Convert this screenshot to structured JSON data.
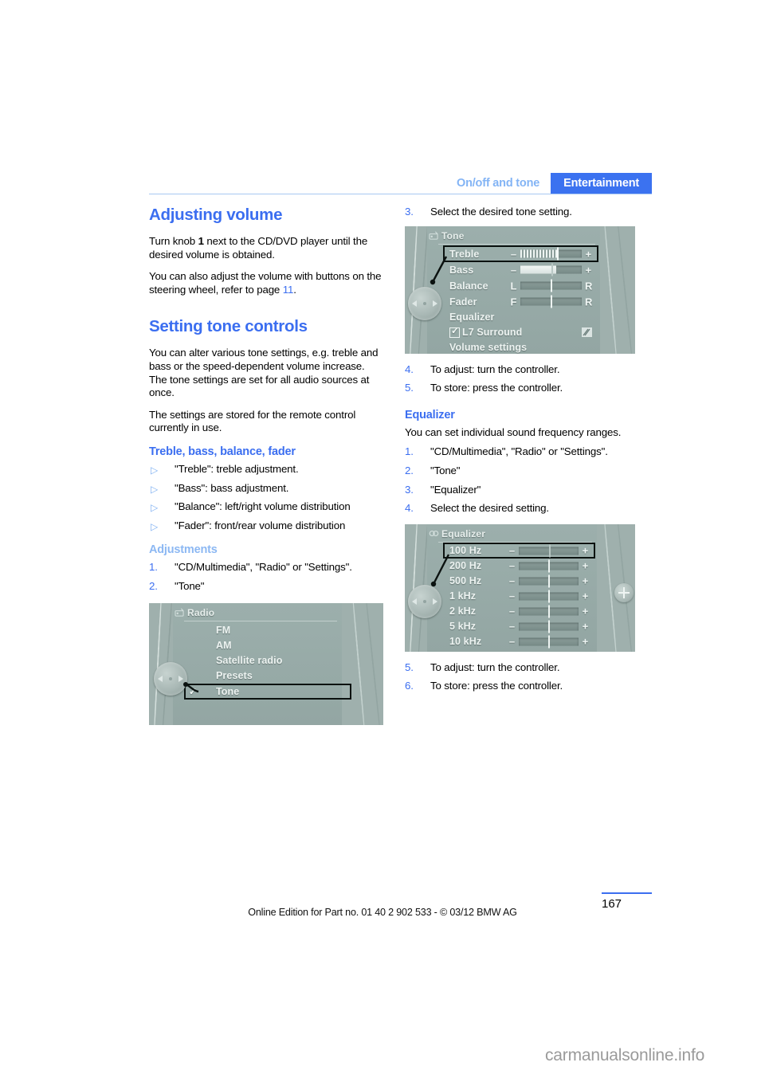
{
  "header": {
    "secondary_tab": "On/off and tone",
    "primary_tab": "Entertainment"
  },
  "colors": {
    "accent_blue": "#3b6ef0",
    "light_blue": "#8cb8f3",
    "tab_blue": "#3b72f0",
    "screen_gray": "#9fb0ad"
  },
  "left_column": {
    "heading_volume": "Adjusting volume",
    "para_volume_1_pre": "Turn knob ",
    "para_volume_1_bold": "1",
    "para_volume_1_post": " next to the CD/DVD player until the desired volume is obtained.",
    "para_volume_2_pre": "You can also adjust the volume with buttons on the steering wheel, refer to page ",
    "para_volume_2_link": "11",
    "para_volume_2_post": ".",
    "heading_tone": "Setting tone controls",
    "para_tone_1": "You can alter various tone settings, e.g. treble and bass or the speed-dependent volume increase.",
    "para_tone_2": "The tone settings are set for all audio sources at once.",
    "para_tone_3": "The settings are stored for the remote control currently in use.",
    "heading_tbbf": "Treble, bass, balance, fader",
    "tbbf_items": [
      "\"Treble\": treble adjustment.",
      "\"Bass\": bass adjustment.",
      "\"Balance\": left/right volume distribution",
      "\"Fader\": front/rear volume distribution"
    ],
    "heading_adjustments": "Adjustments",
    "adjustment_steps": [
      {
        "num": "1.",
        "text": "\"CD/Multimedia\", \"Radio\" or \"Settings\"."
      },
      {
        "num": "2.",
        "text": "\"Tone\""
      }
    ]
  },
  "right_column": {
    "step_3": {
      "num": "3.",
      "text": "Select the desired tone setting."
    },
    "tone_steps": [
      {
        "num": "4.",
        "text": "To adjust: turn the controller."
      },
      {
        "num": "5.",
        "text": "To store: press the controller."
      }
    ],
    "heading_equalizer": "Equalizer",
    "para_equalizer": "You can set individual sound frequency ranges.",
    "equalizer_steps": [
      {
        "num": "1.",
        "text": "\"CD/Multimedia\", \"Radio\" or \"Settings\"."
      },
      {
        "num": "2.",
        "text": "\"Tone\""
      },
      {
        "num": "3.",
        "text": "\"Equalizer\""
      },
      {
        "num": "4.",
        "text": "Select the desired setting."
      }
    ],
    "equalizer_after_steps": [
      {
        "num": "5.",
        "text": "To adjust: turn the controller."
      },
      {
        "num": "6.",
        "text": "To store: press the controller."
      }
    ]
  },
  "figures": {
    "radio": {
      "title": "Radio",
      "items": [
        {
          "label": "FM",
          "highlighted": false,
          "checked": false
        },
        {
          "label": "AM",
          "highlighted": false,
          "checked": false
        },
        {
          "label": "Satellite radio",
          "highlighted": false,
          "checked": false
        },
        {
          "label": "Presets",
          "highlighted": false,
          "checked": false
        },
        {
          "label": "Tone",
          "highlighted": true,
          "checked": true
        }
      ]
    },
    "tone": {
      "title": "Tone",
      "rows": [
        {
          "label": "Treble",
          "highlighted": true,
          "left_sign": "–",
          "right_sign": "+",
          "type": "hatch"
        },
        {
          "label": "Bass",
          "highlighted": false,
          "left_sign": "–",
          "right_sign": "+",
          "type": "fill"
        },
        {
          "label": "Balance",
          "highlighted": false,
          "left_sign": "L",
          "right_sign": "R",
          "type": "center"
        },
        {
          "label": "Fader",
          "highlighted": false,
          "left_sign": "F",
          "right_sign": "R",
          "type": "center"
        },
        {
          "label": "Equalizer",
          "highlighted": false,
          "type": "none"
        },
        {
          "label": "L7 Surround",
          "highlighted": false,
          "type": "checkbox"
        },
        {
          "label": "Volume settings",
          "highlighted": false,
          "type": "none"
        }
      ]
    },
    "equalizer": {
      "title": "Equalizer",
      "bands": [
        {
          "label": "100 Hz",
          "highlighted": true
        },
        {
          "label": "200 Hz",
          "highlighted": false
        },
        {
          "label": "500 Hz",
          "highlighted": false
        },
        {
          "label": "1 kHz",
          "highlighted": false
        },
        {
          "label": "2 kHz",
          "highlighted": false
        },
        {
          "label": "5 kHz",
          "highlighted": false
        },
        {
          "label": "10 kHz",
          "highlighted": false
        }
      ],
      "left_sign": "–",
      "right_sign": "+"
    }
  },
  "footer": {
    "note": "Online Edition for Part no. 01 40 2 902 533 - © 03/12 BMW AG",
    "page_number": "167",
    "watermark": "carmanualsonline.info"
  }
}
